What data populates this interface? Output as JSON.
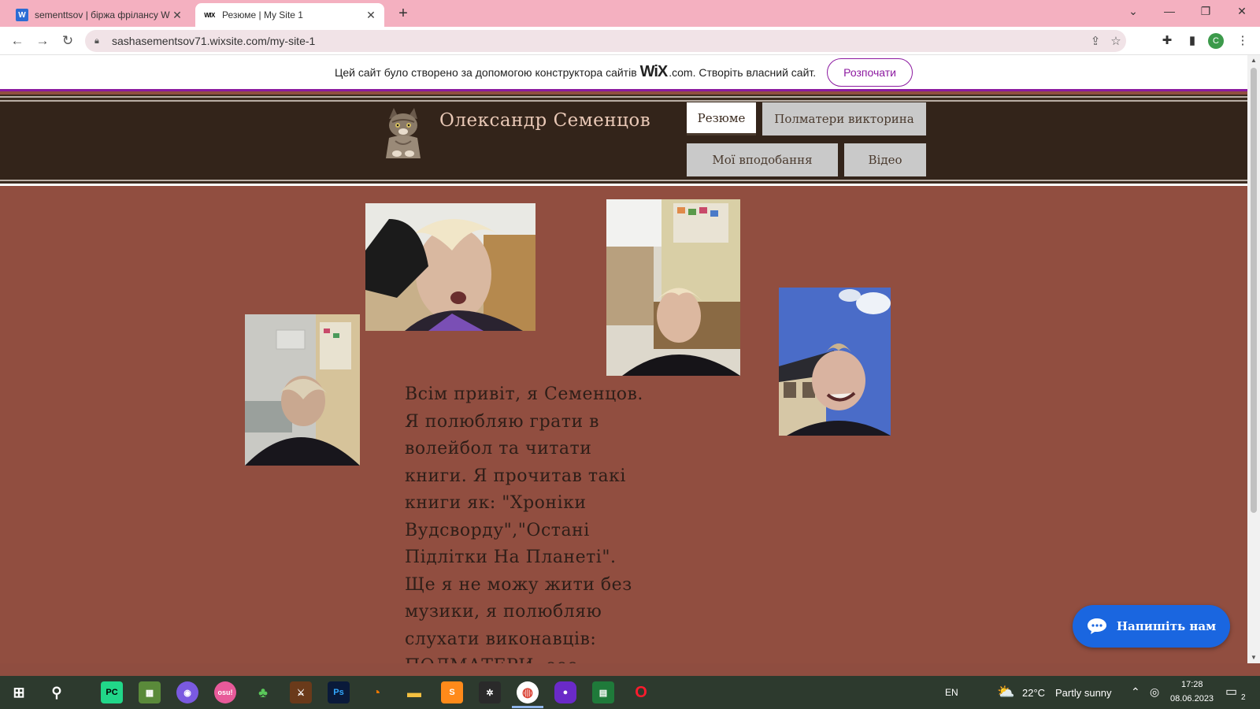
{
  "browser": {
    "tabs": [
      {
        "favicon": "W",
        "title": "sementtsov | біржа фрілансу We",
        "active": false
      },
      {
        "favicon": "WIX",
        "title": "Резюме | My Site 1",
        "active": true
      }
    ],
    "url": "sashasementsov71.wixsite.com/my-site-1",
    "profile_initial": "C"
  },
  "wix_banner": {
    "text_before": "Цей сайт було створено за допомогою конструктора сайтів",
    "logo": "WiX",
    "text_after": ".com. Створіть власний сайт.",
    "button": "Розпочати"
  },
  "site": {
    "title": "Олександр Семенцов",
    "menu": [
      {
        "label": "Резюме",
        "active": true
      },
      {
        "label": "Полматери викторина",
        "active": false
      },
      {
        "label": "Мої вподобання",
        "active": false
      },
      {
        "label": "Відео",
        "active": false
      }
    ],
    "bio_lines": [
      "Всім привіт, я Семенцов.",
      "Я полюбляю грати в",
      "волейбол та читати",
      "книги. Я прочитав такі",
      "книги як: \"Хроніки",
      "Вудсворду\",\"Остані",
      "Підлітки На Планеті\".",
      "Ще я не можу жити без",
      "музики, я полюбляю",
      "слухати виконавців:",
      "ПОЛМАТЕРИ, ооо;"
    ],
    "chat_button": "Напишіть нам"
  },
  "taskbar": {
    "language": "EN",
    "weather_temp": "22°C",
    "weather_desc": "Partly sunny",
    "time": "17:28",
    "date": "08.06.2023",
    "notifications": "2",
    "apps": [
      "windows-start",
      "search",
      "pycharm",
      "minecraft",
      "discord",
      "osu",
      "tree-app",
      "game-app",
      "photoshop",
      "blender",
      "file-explorer",
      "sublime",
      "davinci",
      "chrome",
      "purple-app",
      "excel-like",
      "opera"
    ]
  }
}
